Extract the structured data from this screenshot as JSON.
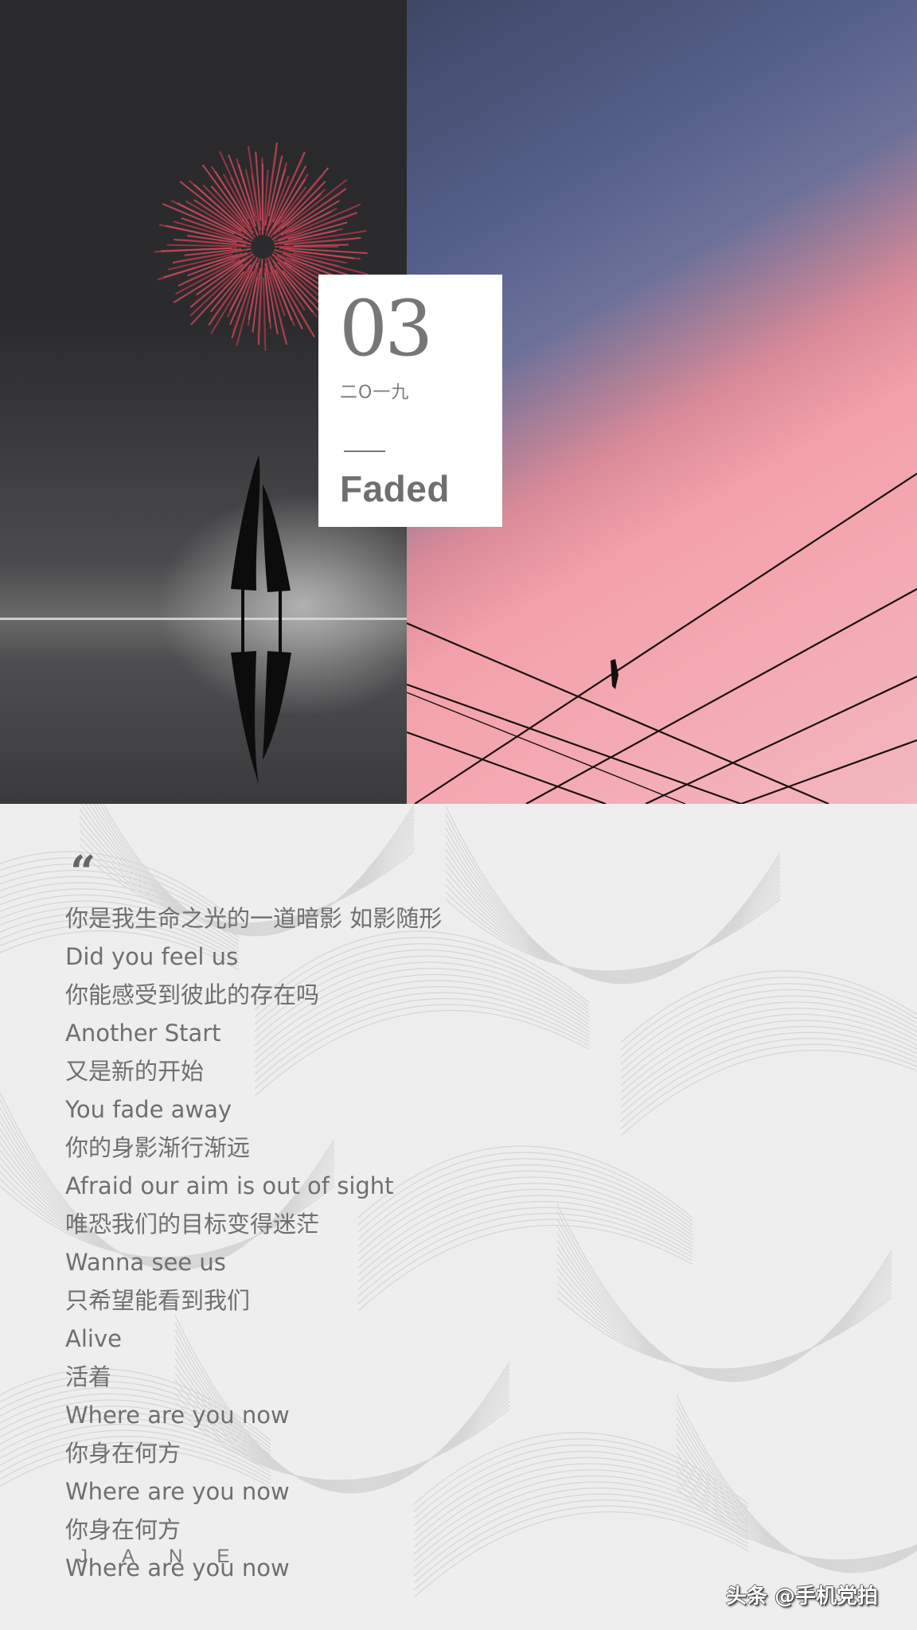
{
  "card": {
    "number": "03",
    "year": "二O一九",
    "title": "Faded"
  },
  "photos": {
    "left": "fireworks-over-trees-reflection",
    "right": "bird-on-wires-pink-sky"
  },
  "quote_icon": "“",
  "lyrics": [
    "你是我生命之光的一道暗影 如影随形",
    "Did you feel us",
    "你能感受到彼此的存在吗",
    "Another Start",
    "又是新的开始",
    "You fade away",
    "你的身影渐行渐远",
    "Afraid our aim is out of sight",
    "唯恐我们的目标变得迷茫",
    "Wanna see us",
    "只希望能看到我们",
    "Alive",
    "活着",
    "Where are you now",
    "你身在何方",
    "Where are you now",
    "你身在何方",
    "Where are you now"
  ],
  "signature": "JANE",
  "watermark": "头条 @手机党拍",
  "colors": {
    "text": "#6f6f6f",
    "card_bg": "#ffffff",
    "background": "#eeeeee",
    "sky_pink": "#f4aab3",
    "sky_blue": "#55608a"
  }
}
